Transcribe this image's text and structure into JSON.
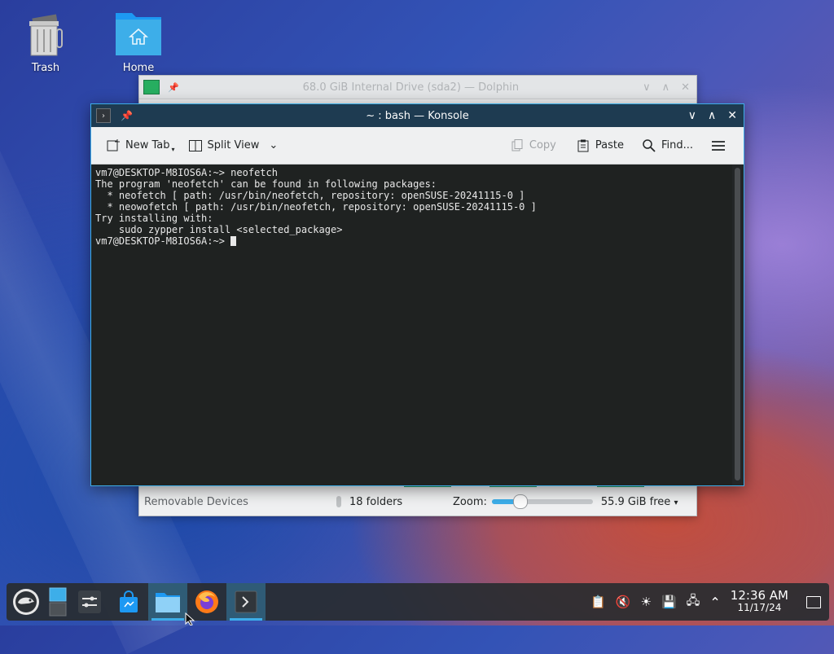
{
  "desktop": {
    "icons": [
      {
        "label": "Trash"
      },
      {
        "label": "Home"
      }
    ]
  },
  "dolphin": {
    "title": "68.0 GiB Internal Drive (sda2) — Dolphin",
    "sidebar_item": "Removable Devices",
    "status_folders": "18 folders",
    "zoom_label": "Zoom:",
    "zoom_level": 0.2,
    "free_space": "55.9 GiB free"
  },
  "konsole": {
    "title": "~ : bash — Konsole",
    "toolbar": {
      "new_tab": "New Tab",
      "split_view": "Split View",
      "copy": "Copy",
      "paste": "Paste",
      "find": "Find..."
    },
    "terminal_lines": [
      "vm7@DESKTOP-M8IOS6A:~> neofetch",
      "",
      "The program 'neofetch' can be found in following packages:",
      "  * neofetch [ path: /usr/bin/neofetch, repository: openSUSE-20241115-0 ]",
      "  * neowofetch [ path: /usr/bin/neofetch, repository: openSUSE-20241115-0 ]",
      "",
      "Try installing with:",
      "    sudo zypper install <selected_package>",
      ""
    ],
    "prompt": "vm7@DESKTOP-M8IOS6A:~> "
  },
  "taskbar": {
    "clock_time": "12:36 AM",
    "clock_date": "11/17/24"
  },
  "colors": {
    "accent": "#3daee9",
    "konsole_titlebar": "#1e3b51",
    "terminal_bg": "#1f2221",
    "folder_blue": "#3daee9",
    "firefox_orange": "#ff7a18",
    "opensuse_green": "#73ba25"
  }
}
